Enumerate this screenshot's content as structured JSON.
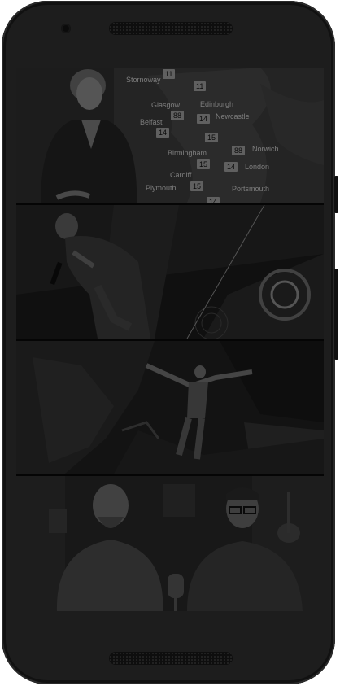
{
  "weather_map": {
    "cities": [
      {
        "name": "Stornoway",
        "temp": "11"
      },
      {
        "name": "Glasgow",
        "temp": "88"
      },
      {
        "name": "Edinburgh",
        "temp": "11"
      },
      {
        "name": "Belfast",
        "temp": "14"
      },
      {
        "name": "Newcastle",
        "temp": "14"
      },
      {
        "name": "Birmingham",
        "temp": "15"
      },
      {
        "name": "Norwich",
        "temp": "88"
      },
      {
        "name": "Cardiff",
        "temp": "15"
      },
      {
        "name": "London",
        "temp": "14"
      },
      {
        "name": "Plymouth",
        "temp": "15"
      },
      {
        "name": "Portsmouth",
        "temp": "14"
      }
    ],
    "extra_temps": [
      "14",
      "15"
    ]
  }
}
